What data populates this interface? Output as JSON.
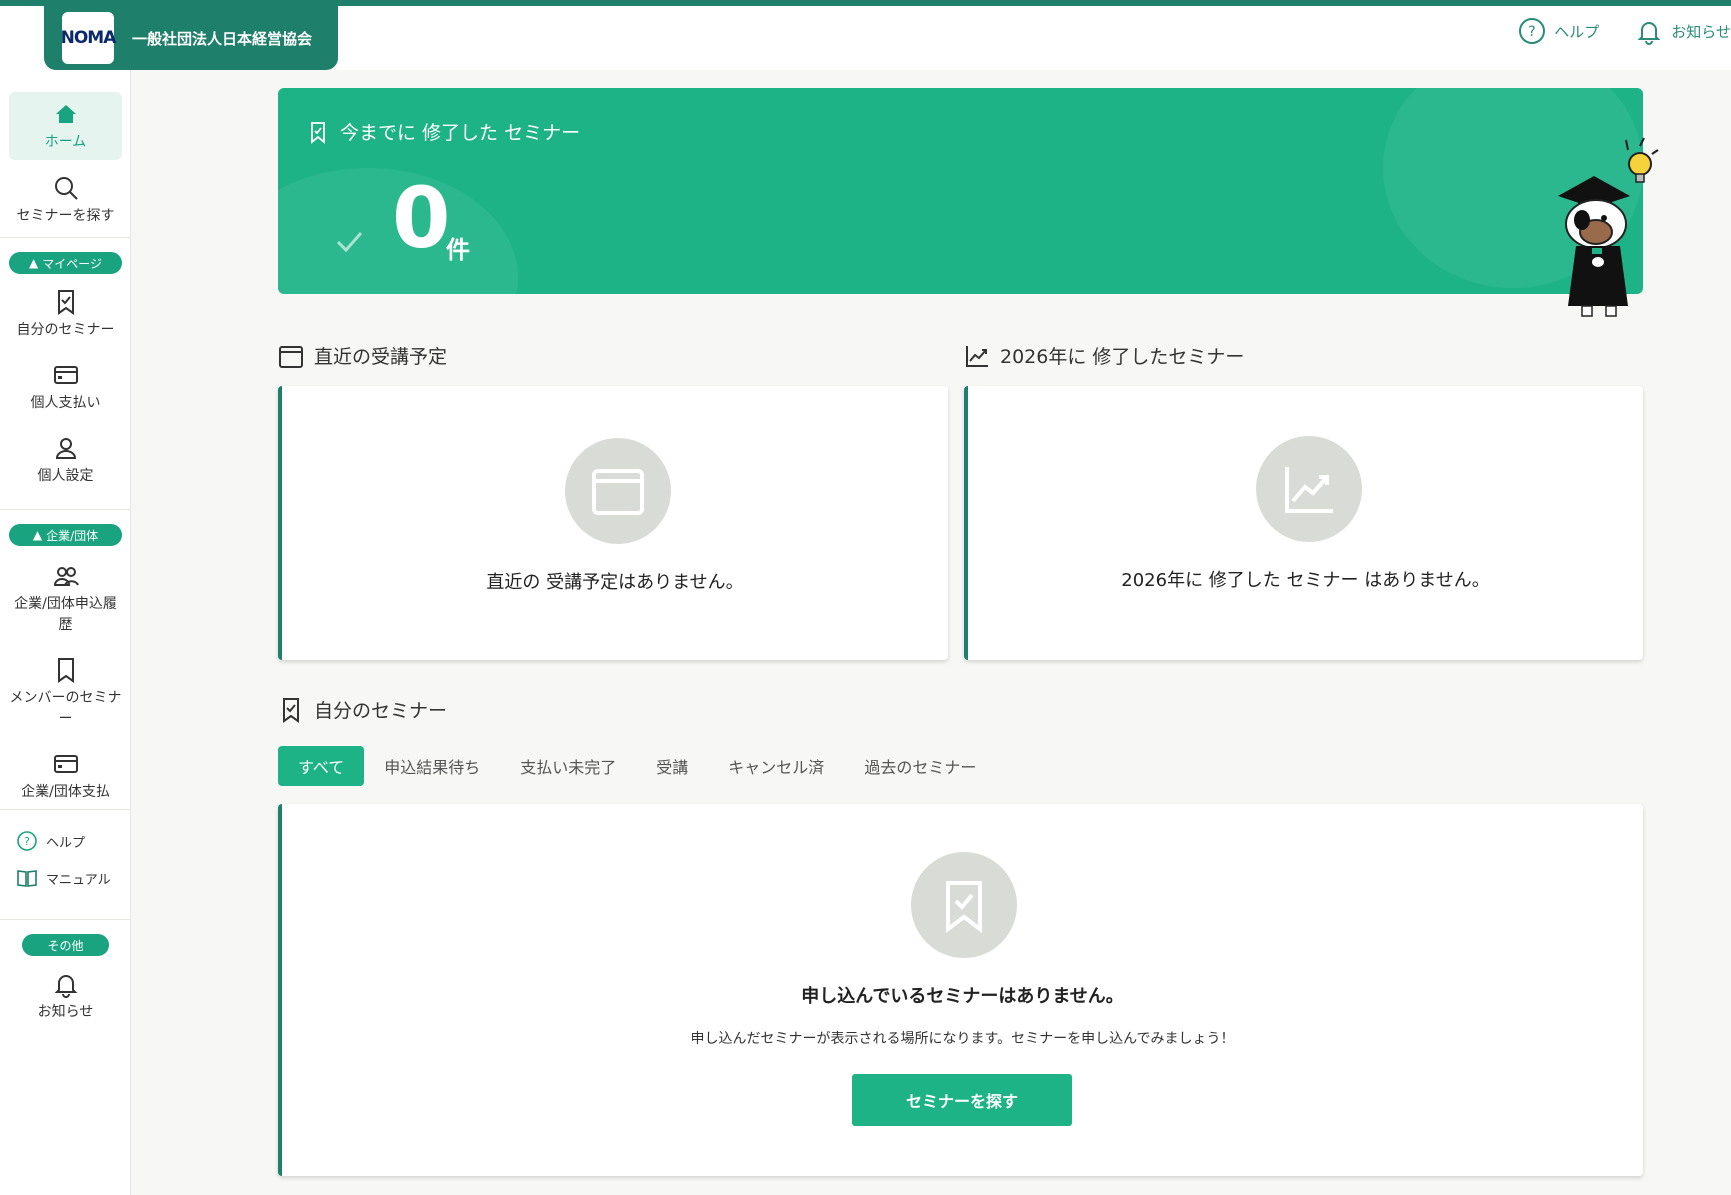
{
  "header": {
    "logo_text": "NOMA",
    "org_name": "一般社団法人日本経営協会",
    "actions": [
      {
        "label": "ヘルプ",
        "icon": "help-circle-icon"
      },
      {
        "label": "お知らせ",
        "icon": "bell-icon"
      }
    ]
  },
  "sidebar": {
    "home": "ホーム",
    "search": "セミナーを探す",
    "mypage_group": "マイページ",
    "my_seminars": "自分のセミナー",
    "personal_payment": "個人支払い",
    "personal_settings": "個人設定",
    "corp_group": "企業/団体",
    "corp_history": "企業/団体申込履歴",
    "member_seminars": "メンバーのセミナー",
    "corp_payment": "企業/団体支払",
    "help": "ヘルプ",
    "manual": "マニュアル",
    "other_group": "その他",
    "notices": "お知らせ"
  },
  "banner": {
    "title": "今までに 修了した セミナー",
    "count": "0",
    "unit": "件"
  },
  "upcoming": {
    "title": "直近の受講予定",
    "empty": "直近の 受講予定はありません。"
  },
  "completed_year": {
    "title": "2026年に 修了したセミナー",
    "empty": "2026年に 修了した セミナー はありません。"
  },
  "my_seminars": {
    "title": "自分のセミナー",
    "tabs": [
      "すべて",
      "申込結果待ち",
      "支払い未完了",
      "受講",
      "キャンセル済",
      "過去のセミナー"
    ],
    "active_tab": 0,
    "empty_title": "申し込んでいるセミナーはありません。",
    "empty_desc": "申し込んだセミナーが表示される場所になります。セミナーを申し込んでみましょう！",
    "cta": "セミナーを探す"
  },
  "colors": {
    "primary": "#1db386",
    "dark": "#1e7f6a",
    "empty_circle": "#d9dcd6"
  }
}
